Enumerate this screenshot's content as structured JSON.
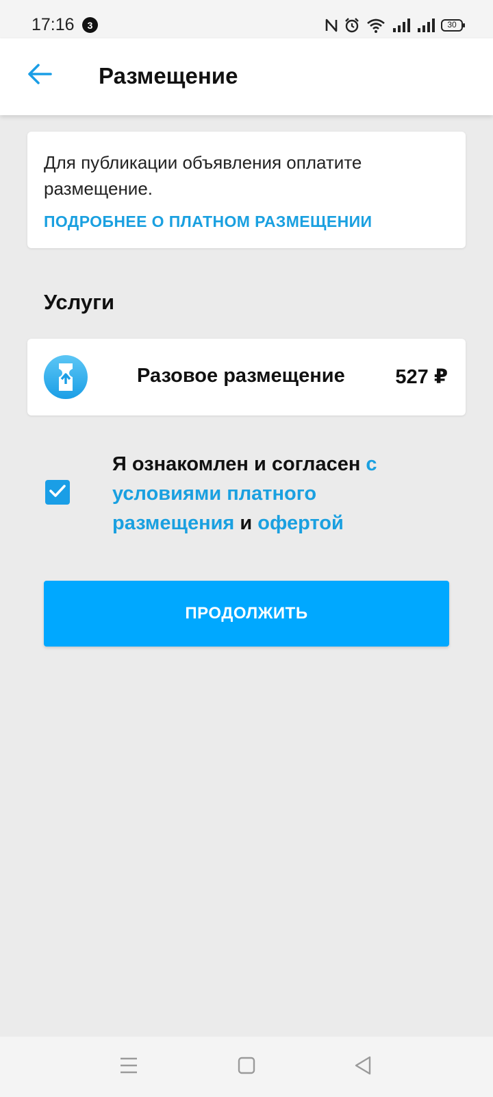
{
  "status_bar": {
    "time": "17:16",
    "notification_count": "3",
    "battery": "30",
    "icons": [
      "nfc-icon",
      "alarm-icon",
      "wifi-icon",
      "signal-icon",
      "signal-icon",
      "battery-icon"
    ]
  },
  "header": {
    "back_icon": "arrow-left-icon",
    "title": "Размещение"
  },
  "info_card": {
    "text": "Для публикации объявления оплатите размещение.",
    "link": "ПОДРОБНЕЕ О ПЛАТНОМ РАЗМЕЩЕНИИ"
  },
  "services": {
    "title": "Услуги",
    "items": [
      {
        "icon": "ticket-upload-icon",
        "name": "Разовое размещение",
        "price": "527 ₽"
      }
    ]
  },
  "agreement": {
    "checked": true,
    "text_before": "Я ознакомлен и согласен ",
    "link_terms": "с условиями платного размещения",
    "text_and": " и ",
    "link_offer": "офертой"
  },
  "continue_button": "ПРОДОЛЖИТЬ",
  "nav_bar": {
    "icons": [
      "menu-icon",
      "home-square-icon",
      "back-triangle-icon"
    ]
  },
  "colors": {
    "accent": "#1aa0e0",
    "button": "#00a8ff",
    "background": "#ebebeb"
  }
}
